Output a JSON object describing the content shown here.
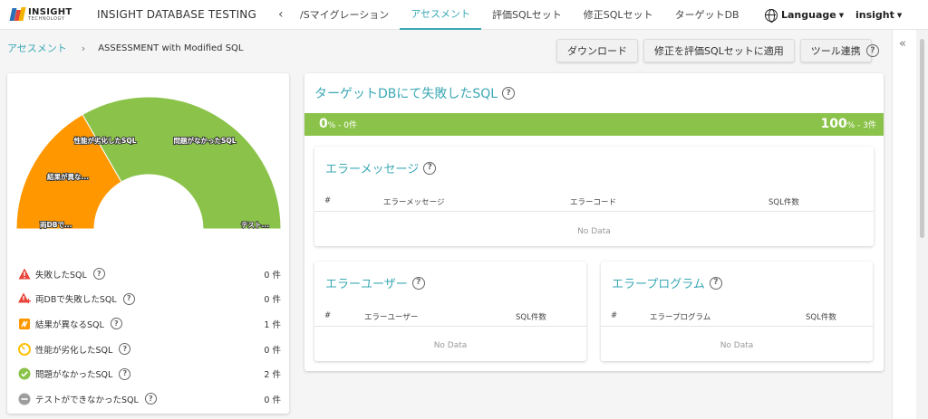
{
  "header": {
    "logo_text": "INSIGHT",
    "logo_sub": "TECHNOLOGY",
    "app_title": "INSIGHT DATABASE TESTING",
    "tabs": [
      {
        "label": "/Sマイグレーション"
      },
      {
        "label": "アセスメント",
        "active": true
      },
      {
        "label": "評価SQLセット"
      },
      {
        "label": "修正SQLセット"
      },
      {
        "label": "ターゲットDB"
      }
    ],
    "language_label": "Language",
    "user_label": "insight"
  },
  "breadcrumb": {
    "parent": "アセスメント",
    "current": "ASSESSMENT with Modified SQL"
  },
  "actions": {
    "download": "ダウンロード",
    "apply": "修正を評価SQLセットに適用",
    "tools": "ツール連携"
  },
  "gauge": {
    "slices": [
      {
        "label": "両DBで...",
        "value": 0,
        "color": "#e8443a"
      },
      {
        "label": "結果が異な...",
        "value": 1,
        "color": "#ff9800"
      },
      {
        "label": "性能が劣化したSQL",
        "value": 0,
        "color": "#ffc107"
      },
      {
        "label": "問題がなかったSQL",
        "value": 2,
        "color": "#8bc34a"
      },
      {
        "label": "テスト...",
        "value": 0,
        "color": "#9e9e9e"
      }
    ]
  },
  "legend": [
    {
      "label": "失敗したSQL",
      "count": "0 件",
      "icon": "warning-icon",
      "color": "#e8443a"
    },
    {
      "label": "両DBで失敗したSQL",
      "count": "0 件",
      "icon": "warning-plus-icon",
      "color": "#e8443a"
    },
    {
      "label": "結果が異なるSQL",
      "count": "1 件",
      "icon": "diff-icon",
      "color": "#ff9800"
    },
    {
      "label": "性能が劣化したSQL",
      "count": "0 件",
      "icon": "speed-icon",
      "color": "#ffc107"
    },
    {
      "label": "問題がなかったSQL",
      "count": "2 件",
      "icon": "check-circle-icon",
      "color": "#8bc34a"
    },
    {
      "label": "テストができなかったSQL",
      "count": "0 件",
      "icon": "minus-circle-icon",
      "color": "#9e9e9e"
    }
  ],
  "failed": {
    "title": "ターゲットDBにて失敗したSQL",
    "progress_left": "0",
    "progress_left_unit": "% - 0件",
    "progress_right": "100",
    "progress_right_unit": "% - 3件",
    "progress_color": "#8bc34a"
  },
  "error_messages": {
    "title": "エラーメッセージ",
    "columns": [
      "#",
      "エラーメッセージ",
      "エラーコード",
      "SQL件数"
    ],
    "empty": "No Data"
  },
  "error_users": {
    "title": "エラーユーザー",
    "columns": [
      "#",
      "エラーユーザー",
      "SQL件数"
    ],
    "empty": "No Data"
  },
  "error_programs": {
    "title": "エラープログラム",
    "columns": [
      "#",
      "エラープログラム",
      "SQL件数"
    ],
    "empty": "No Data"
  },
  "accent_color": "#3aa8b4"
}
